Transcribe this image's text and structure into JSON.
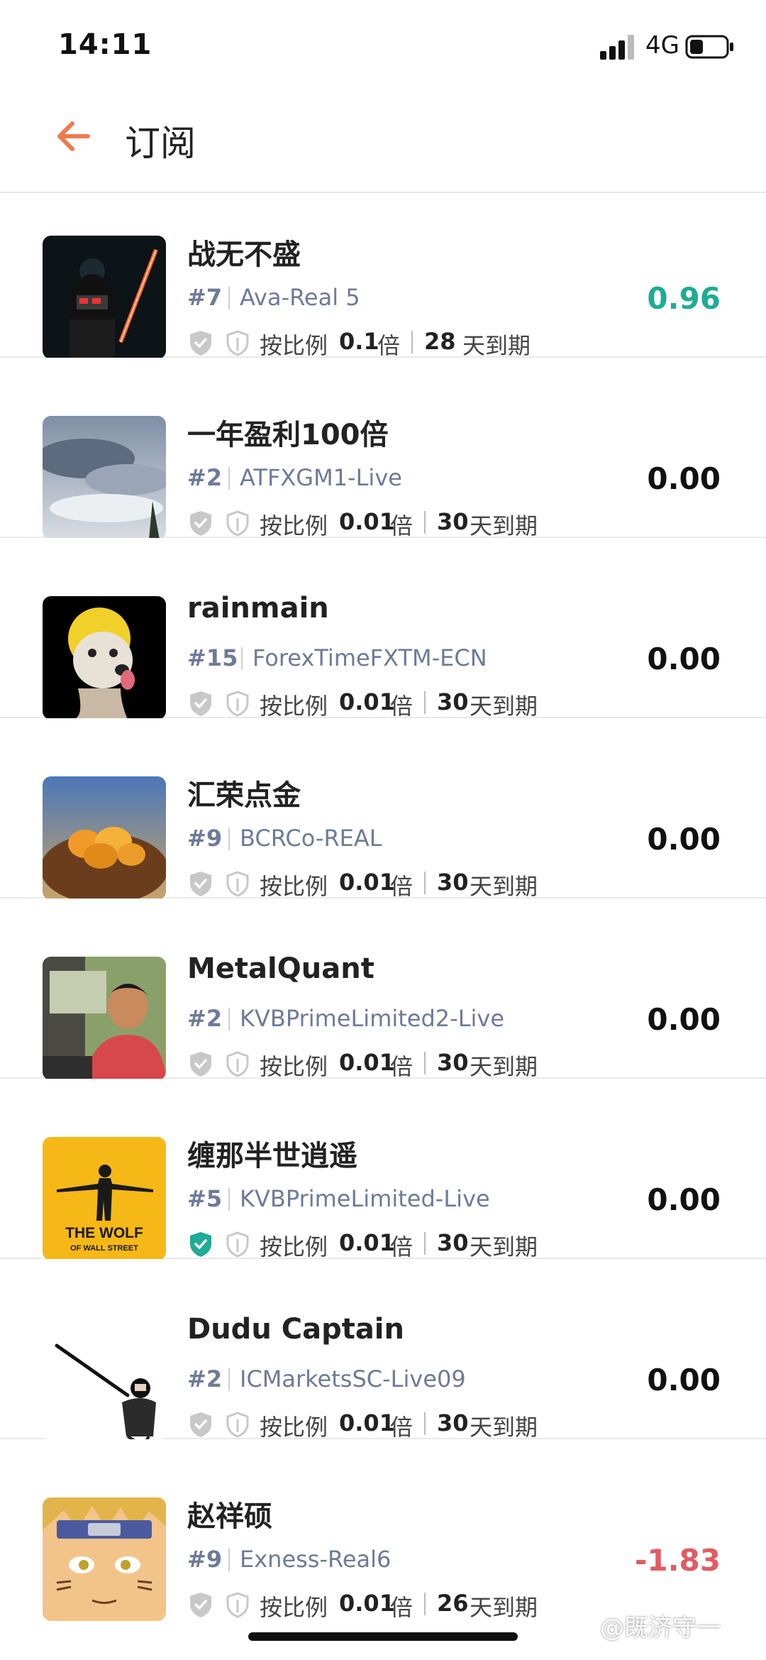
{
  "status_bar": {
    "time": "14:11",
    "network": "4G"
  },
  "header": {
    "title": "订阅"
  },
  "labels": {
    "ratio": "按比例",
    "multiplier": "倍",
    "expire": "天到期"
  },
  "colors": {
    "accent": "#f07a4f",
    "positive": "#1fab95",
    "negative": "#e25b62",
    "verified": "#1fab95"
  },
  "subscriptions": [
    {
      "name": "战无不盛",
      "rank": "#7",
      "server": "Ava-Real 5",
      "ratio": "0.1",
      "days": "28",
      "value": "0.96",
      "value_state": "positive",
      "verified": false,
      "avatar_icon": "darth-vader-avatar"
    },
    {
      "name": "一年盈利100倍",
      "rank": "#2",
      "server": "ATFXGM1-Live",
      "ratio": "0.01",
      "days": "30",
      "value": "0.00",
      "value_state": "neutral",
      "verified": false,
      "avatar_icon": "sky-clouds-avatar"
    },
    {
      "name": "rainmain",
      "rank": "#15",
      "server": "ForexTimeFXTM-ECN",
      "ratio": "0.01",
      "days": "30",
      "value": "0.00",
      "value_state": "neutral",
      "verified": false,
      "avatar_icon": "dog-avatar"
    },
    {
      "name": "汇荣点金",
      "rank": "#9",
      "server": "BCRCo-REAL",
      "ratio": "0.01",
      "days": "30",
      "value": "0.00",
      "value_state": "neutral",
      "verified": false,
      "avatar_icon": "golden-eggs-avatar"
    },
    {
      "name": "MetalQuant",
      "rank": "#2",
      "server": "KVBPrimeLimited2-Live",
      "ratio": "0.01",
      "days": "30",
      "value": "0.00",
      "value_state": "neutral",
      "verified": false,
      "avatar_icon": "person-in-car-avatar"
    },
    {
      "name": "缠那半世逍遥",
      "rank": "#5",
      "server": "KVBPrimeLimited-Live",
      "ratio": "0.01",
      "days": "30",
      "value": "0.00",
      "value_state": "neutral",
      "verified": true,
      "avatar_icon": "wolf-of-wall-street-avatar",
      "avatar_text": "THE WOLF",
      "avatar_subtext": "OF WALL STREET"
    },
    {
      "name": "Dudu Captain",
      "rank": "#2",
      "server": "ICMarketsSC-Live09",
      "ratio": "0.01",
      "days": "30",
      "value": "0.00",
      "value_state": "neutral",
      "verified": false,
      "avatar_icon": "swordsman-avatar"
    },
    {
      "name": "赵祥硕",
      "rank": "#9",
      "server": "Exness-Real6",
      "ratio": "0.01",
      "days": "26",
      "value": "-1.83",
      "value_state": "negative",
      "verified": false,
      "avatar_icon": "naruto-avatar"
    }
  ],
  "watermark": "@既济守一"
}
